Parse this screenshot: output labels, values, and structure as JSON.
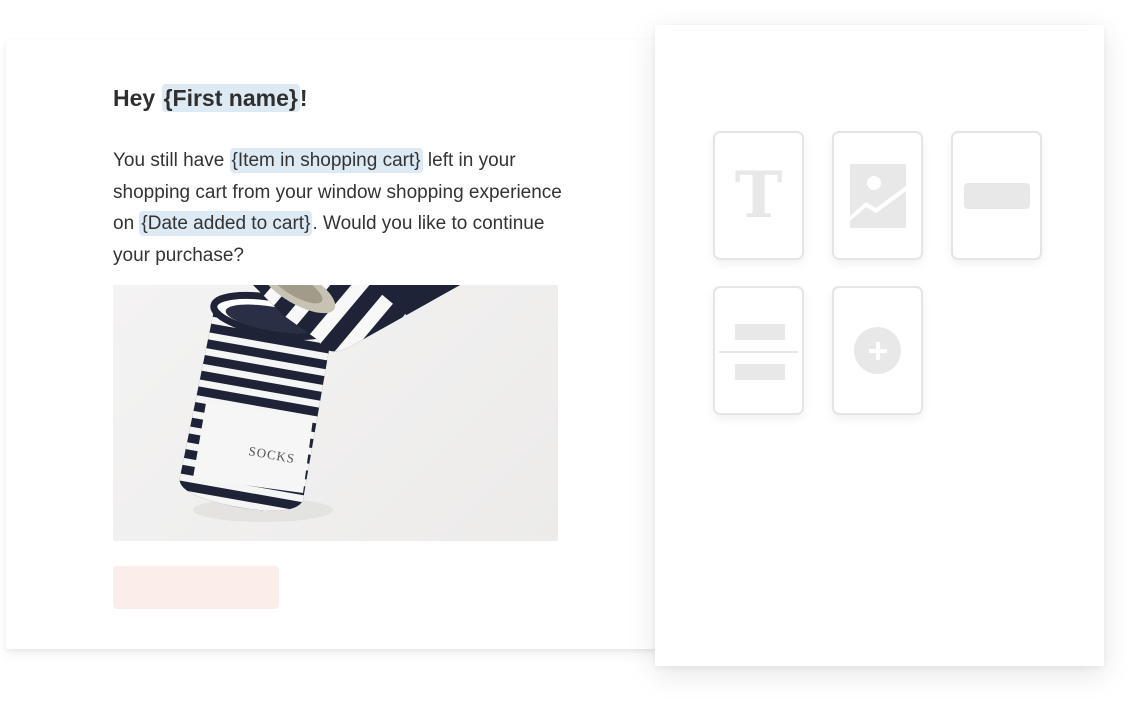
{
  "email": {
    "greeting_prefix": "Hey ",
    "greeting_tag": "{First name}",
    "greeting_suffix": "!",
    "body_part1": "You still have ",
    "tag_item": "{Item in shopping cart}",
    "body_part2": " left in your shopping cart from your window shopping experience on ",
    "tag_date": "{Date added to cart}",
    "body_part3": ". Would you like to continue your purchase?",
    "image": {
      "subject": "striped-socks-in-can",
      "label": "SOCKS"
    },
    "cta": {
      "label": "",
      "color": "#fbeeea"
    },
    "merge_tag_color": "#dde9f3"
  },
  "blocks_panel": {
    "tiles": [
      {
        "type": "text",
        "icon": "text-icon"
      },
      {
        "type": "image",
        "icon": "image-icon"
      },
      {
        "type": "button",
        "icon": "button-icon"
      },
      {
        "type": "divider",
        "icon": "divider-icon"
      },
      {
        "type": "add",
        "icon": "add-icon"
      }
    ],
    "text_glyph": "T",
    "placeholder_color": "#e8e8e8"
  }
}
